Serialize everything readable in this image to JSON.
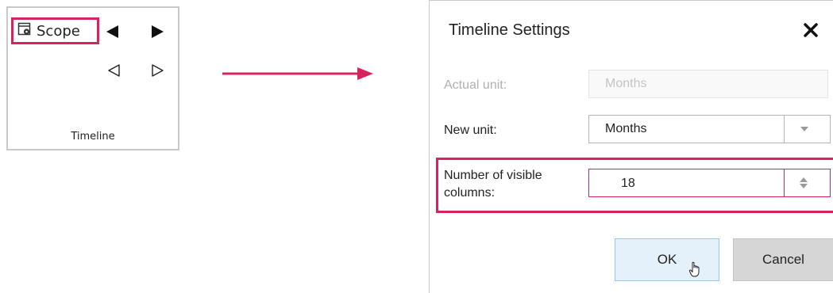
{
  "ribbon": {
    "scope_label": "Scope",
    "group_label": "Timeline",
    "icons": [
      "scope-settings-icon",
      "previous-page-icon",
      "next-page-icon",
      "previous-step-icon",
      "next-step-icon"
    ]
  },
  "dialog": {
    "title": "Timeline Settings",
    "actual_unit_label": "Actual unit:",
    "actual_unit_value": "Months",
    "new_unit_label": "New unit:",
    "new_unit_value": "Months",
    "visible_columns_label_line1": "Number of visible",
    "visible_columns_label_line2": "columns:",
    "visible_columns_value": "18",
    "ok_label": "OK",
    "cancel_label": "Cancel"
  },
  "colors": {
    "highlight": "#d6245c",
    "ok_button_bg": "#e4f0fa",
    "cancel_button_bg": "#d6d6d6"
  }
}
